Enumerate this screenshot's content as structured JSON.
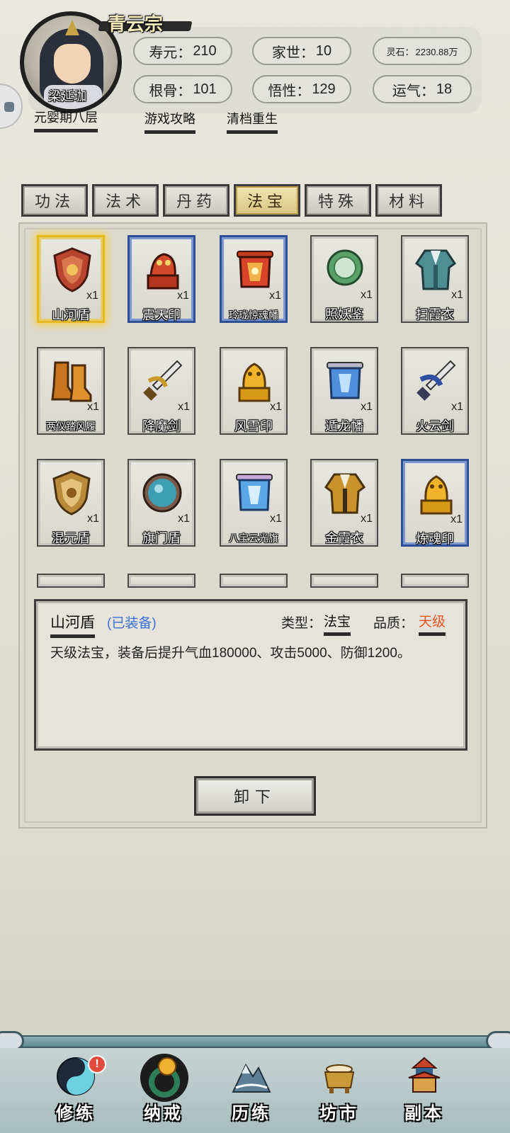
{
  "header": {
    "sect": "青云宗",
    "player_name": "梁延珈",
    "realm": "元婴期八层",
    "stats": [
      {
        "label": "寿元：",
        "value": "210"
      },
      {
        "label": "家世：",
        "value": "10"
      },
      {
        "label": "灵石：",
        "value": "2230.88万"
      },
      {
        "label": "根骨：",
        "value": "101"
      },
      {
        "label": "悟性：",
        "value": "129"
      },
      {
        "label": "运气：",
        "value": "18"
      }
    ],
    "links": [
      "游戏攻略",
      "清档重生"
    ]
  },
  "tabs": [
    {
      "label": "功法",
      "active": false
    },
    {
      "label": "法术",
      "active": false
    },
    {
      "label": "丹药",
      "active": false
    },
    {
      "label": "法宝",
      "active": true
    },
    {
      "label": "特殊",
      "active": false
    },
    {
      "label": "材料",
      "active": false
    }
  ],
  "items": [
    {
      "name": "山河盾",
      "qty": "x1",
      "frame": "gold",
      "icon": "shield-icon"
    },
    {
      "name": "震天印",
      "qty": "x1",
      "frame": "blue",
      "icon": "dragon-seal-icon"
    },
    {
      "name": "玲珑惊魂幡",
      "qty": "x1",
      "frame": "blue",
      "icon": "banner-icon"
    },
    {
      "name": "照妖鉴",
      "qty": "x1",
      "frame": "normal",
      "icon": "mirror-icon"
    },
    {
      "name": "扫霞衣",
      "qty": "x1",
      "frame": "normal",
      "icon": "robe-icon"
    },
    {
      "name": "两仪踏风履",
      "qty": "x1",
      "frame": "normal",
      "icon": "boots-icon"
    },
    {
      "name": "降魔剑",
      "qty": "x1",
      "frame": "normal",
      "icon": "sword-icon"
    },
    {
      "name": "风雪印",
      "qty": "x1",
      "frame": "normal",
      "icon": "seal-icon"
    },
    {
      "name": "遁龙幡",
      "qty": "x1",
      "frame": "normal",
      "icon": "banner-icon"
    },
    {
      "name": "火云剑",
      "qty": "x1",
      "frame": "normal",
      "icon": "sword-icon"
    },
    {
      "name": "混元盾",
      "qty": "x1",
      "frame": "normal",
      "icon": "shield-icon"
    },
    {
      "name": "旗门盾",
      "qty": "x1",
      "frame": "normal",
      "icon": "round-shield-icon"
    },
    {
      "name": "八宝云光旗",
      "qty": "x1",
      "frame": "normal",
      "icon": "banner-icon"
    },
    {
      "name": "金霞衣",
      "qty": "x1",
      "frame": "normal",
      "icon": "robe-icon"
    },
    {
      "name": "炼魂印",
      "qty": "x1",
      "frame": "blue",
      "icon": "seal-icon"
    }
  ],
  "detail": {
    "name": "山河盾",
    "status": "(已装备)",
    "type_label": "类型：",
    "type_value": "法宝",
    "quality_label": "品质：",
    "quality_value": "天级",
    "description": "天级法宝，装备后提升气血180000、攻击5000、防御1200。",
    "action": "卸下"
  },
  "nav": [
    {
      "label": "修练",
      "icon": "yin-yang-icon",
      "badge": "!"
    },
    {
      "label": "纳戒",
      "icon": "ring-icon",
      "active": true
    },
    {
      "label": "历练",
      "icon": "mountain-icon"
    },
    {
      "label": "坊市",
      "icon": "cauldron-icon"
    },
    {
      "label": "副本",
      "icon": "pagoda-icon"
    }
  ],
  "colors": {
    "equipped": "#3a6fd6",
    "quality_top": "#e8541c",
    "frame_blue": "#2d4f96",
    "frame_gold": "#e8b820"
  }
}
